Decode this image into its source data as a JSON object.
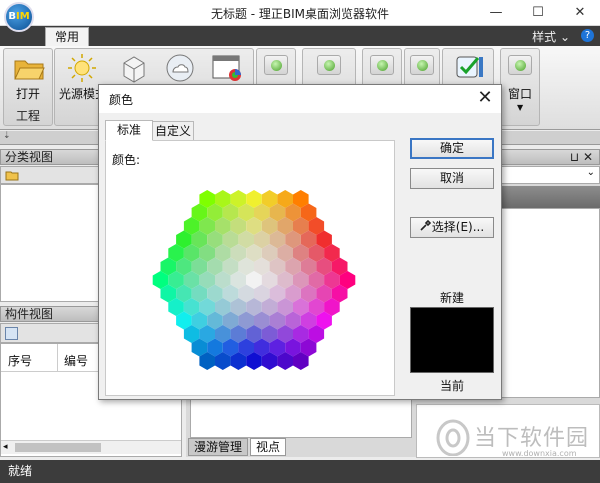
{
  "window": {
    "title": "无标题 - 理正BIM桌面浏览器软件",
    "logo_text_b": "B",
    "logo_text_im": "IM",
    "minimize": "—",
    "maximize": "☐",
    "close": "✕"
  },
  "ribbon": {
    "tab": "常用",
    "style_menu": "样式",
    "groups": {
      "project_label": "工程"
    },
    "buttons": {
      "open": "打开",
      "light_source": "光源模式",
      "window": "窗口"
    }
  },
  "panels": {
    "category_title": "分类视图",
    "component_title": "构件视图",
    "columns": [
      "序号",
      "编号"
    ],
    "bottom_tabs": [
      "漫游管理",
      "视点"
    ]
  },
  "status": {
    "text": "就绪"
  },
  "dialog": {
    "title": "颜色",
    "tabs": [
      "标准",
      "自定义"
    ],
    "color_label": "颜色:",
    "ok": "确定",
    "cancel": "取消",
    "pick": "选择(E)...",
    "new_label": "新建",
    "current_label": "当前",
    "new_color": "#000000"
  },
  "watermark": {
    "text": "当下软件园",
    "url": "www.downxia.com"
  }
}
